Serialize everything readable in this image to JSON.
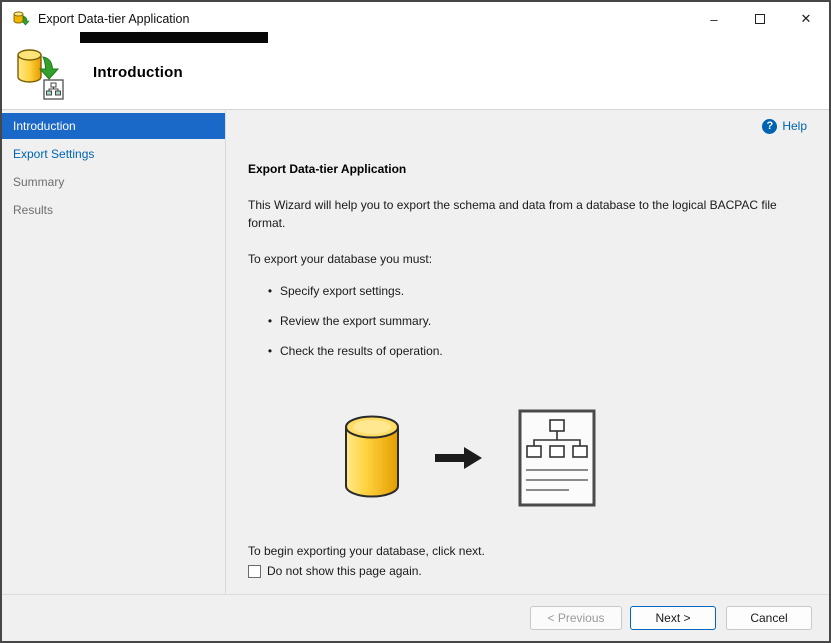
{
  "window": {
    "title": "Export Data-tier Application",
    "controls": {
      "minimize": "–",
      "close": "✕"
    }
  },
  "header": {
    "title": "Introduction"
  },
  "sidebar": {
    "items": [
      {
        "label": "Introduction",
        "state": "active"
      },
      {
        "label": "Export Settings",
        "state": "link"
      },
      {
        "label": "Summary",
        "state": "disabled"
      },
      {
        "label": "Results",
        "state": "disabled"
      }
    ]
  },
  "content": {
    "help_label": "Help",
    "help_icon": "?",
    "heading": "Export Data-tier Application",
    "intro": "This Wizard will help you to export the schema and data from a database to the logical BACPAC file format.",
    "must_label": "To export your database you must:",
    "bullet_char": "•",
    "bullets": [
      "Specify export settings.",
      "Review the export summary.",
      "Check the results of operation."
    ],
    "begin_text": "To begin exporting your database, click next.",
    "checkbox_label": "Do not show this page again.",
    "checkbox_checked": false
  },
  "footer": {
    "previous_label": "< Previous",
    "next_label": "Next >",
    "cancel_label": "Cancel"
  },
  "colors": {
    "accent_blue": "#1a68c7",
    "link_blue": "#0063b1",
    "disabled_text": "#6e6e6e",
    "next_border": "#0067c0",
    "surface_gray": "#f0f0f0"
  }
}
